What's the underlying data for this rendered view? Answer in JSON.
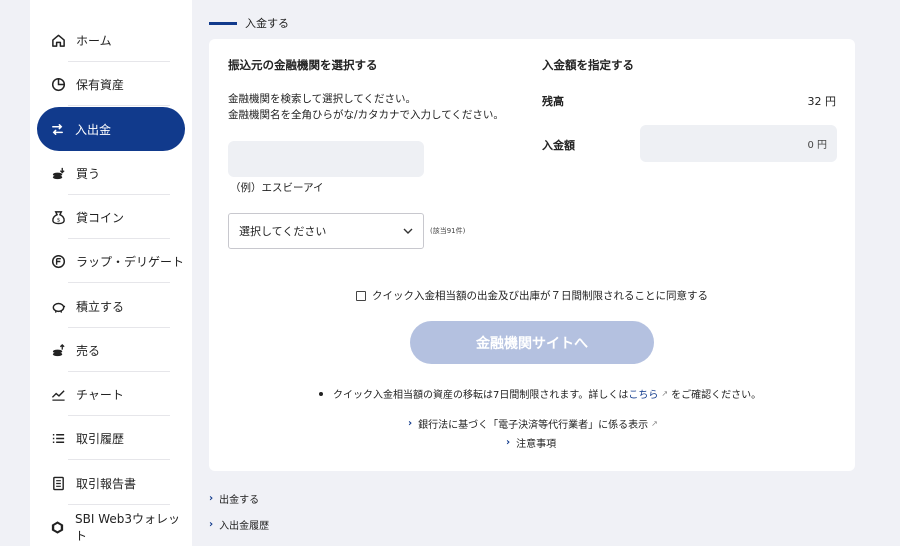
{
  "sidebar": {
    "items": [
      {
        "label": "ホーム",
        "icon": "home-icon"
      },
      {
        "label": "保有資産",
        "icon": "pie-chart-icon"
      },
      {
        "label": "入出金",
        "icon": "transfer-icon",
        "active": true
      },
      {
        "label": "買う",
        "icon": "coins-buy-icon"
      },
      {
        "label": "貸コイン",
        "icon": "money-bag-icon"
      },
      {
        "label": "ラップ・デリゲート",
        "icon": "delegate-icon"
      },
      {
        "label": "積立する",
        "icon": "piggy-bank-icon"
      },
      {
        "label": "売る",
        "icon": "coins-sell-icon"
      },
      {
        "label": "チャート",
        "icon": "chart-icon"
      },
      {
        "label": "取引履歴",
        "icon": "list-icon"
      },
      {
        "label": "取引報告書",
        "icon": "document-icon"
      },
      {
        "label": "SBI Web3ウォレット",
        "icon": "wallet-icon"
      }
    ]
  },
  "section": {
    "title": "入金する"
  },
  "form": {
    "bank_heading": "振込元の金融機関を選択する",
    "bank_desc_line1": "金融機関を検索して選択してください。",
    "bank_desc_line2": "金融機関名を全角ひらがな/カタカナで入力してください。",
    "bank_input_value": "",
    "bank_example": "（例）エスビーアイ",
    "select_value": "選択してください",
    "select_count": "(該当91件)",
    "amount_heading": "入金額を指定する",
    "balance_label": "残高",
    "balance_value": "32 円",
    "amount_label": "入金額",
    "amount_value": "0 円",
    "agree_text": "クイック入金相当額の出金及び出庫が７日間制限されることに同意する",
    "submit_label": "金融機関サイトへ",
    "note_prefix": "クイック入金相当額の資産の移転は7日間制限されます。詳しくは",
    "note_link": "こちら",
    "note_suffix": "をご確認ください。",
    "link_banking": "銀行法に基づく「電子決済等代行業者」に係る表示",
    "link_notes": "注意事項"
  },
  "below": {
    "withdraw": "出金する",
    "history": "入出金履歴"
  },
  "colors": {
    "accent": "#113a8c",
    "button_disabled": "#b4c1e0",
    "input_bg": "#eef0f4"
  }
}
